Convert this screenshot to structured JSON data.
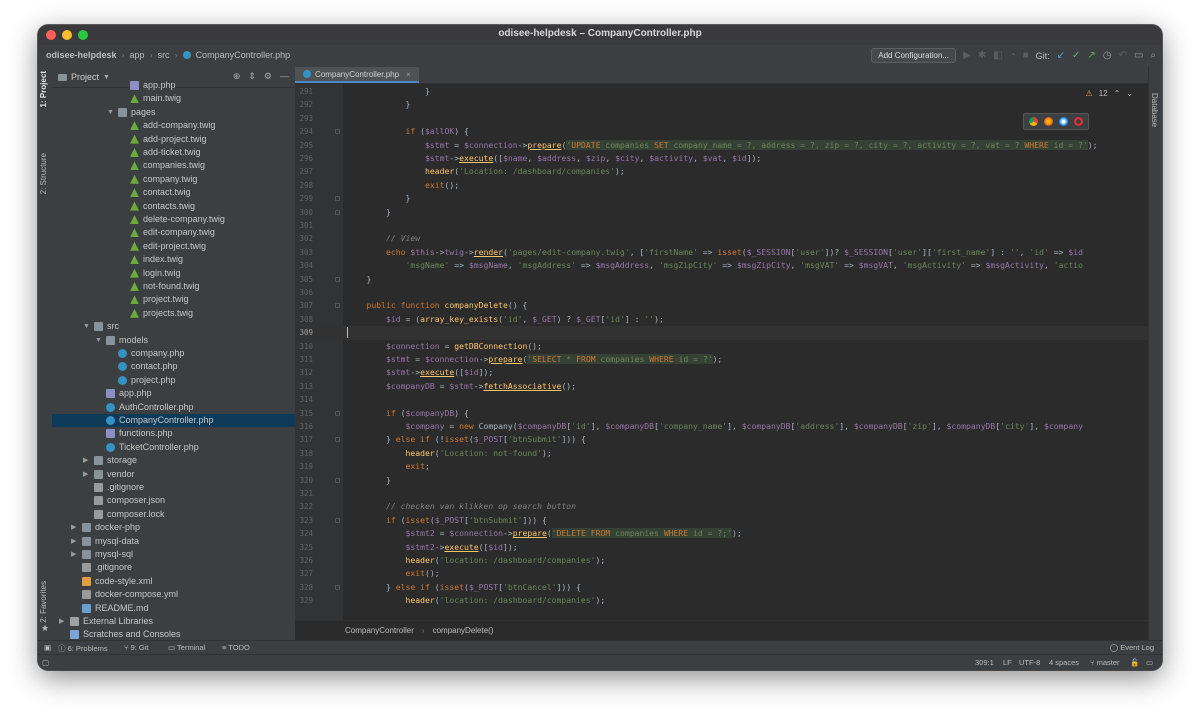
{
  "window": {
    "title": "odisee-helpdesk – CompanyController.php"
  },
  "nav": {
    "crumbs": [
      "odisee-helpdesk",
      "app",
      "src",
      "CompanyController.php"
    ],
    "add_config": "Add Configuration...",
    "git_label": "Git:"
  },
  "side_tabs": {
    "project": "1: Project",
    "structure": "2: Structure",
    "favorites": "2: Favorites"
  },
  "right_tabs": {
    "database": "Database"
  },
  "project": {
    "title": "Project",
    "tree": [
      {
        "label": "app.php",
        "icon": "php",
        "depth": 6
      },
      {
        "label": "main.twig",
        "icon": "twig",
        "depth": 6
      },
      {
        "label": "pages",
        "icon": "folder",
        "depth": 5,
        "arrow": "down"
      },
      {
        "label": "add-company.twig",
        "icon": "twig",
        "depth": 6
      },
      {
        "label": "add-project.twig",
        "icon": "twig",
        "depth": 6
      },
      {
        "label": "add-ticket.twig",
        "icon": "twig",
        "depth": 6
      },
      {
        "label": "companies.twig",
        "icon": "twig",
        "depth": 6
      },
      {
        "label": "company.twig",
        "icon": "twig",
        "depth": 6
      },
      {
        "label": "contact.twig",
        "icon": "twig",
        "depth": 6
      },
      {
        "label": "contacts.twig",
        "icon": "twig",
        "depth": 6
      },
      {
        "label": "delete-company.twig",
        "icon": "twig",
        "depth": 6
      },
      {
        "label": "edit-company.twig",
        "icon": "twig",
        "depth": 6
      },
      {
        "label": "edit-project.twig",
        "icon": "twig",
        "depth": 6
      },
      {
        "label": "index.twig",
        "icon": "twig",
        "depth": 6
      },
      {
        "label": "login.twig",
        "icon": "twig",
        "depth": 6
      },
      {
        "label": "not-found.twig",
        "icon": "twig",
        "depth": 6
      },
      {
        "label": "project.twig",
        "icon": "twig",
        "depth": 6
      },
      {
        "label": "projects.twig",
        "icon": "twig",
        "depth": 6
      },
      {
        "label": "src",
        "icon": "folder",
        "depth": 3,
        "arrow": "down"
      },
      {
        "label": "models",
        "icon": "folder",
        "depth": 4,
        "arrow": "down"
      },
      {
        "label": "company.php",
        "icon": "class",
        "depth": 5
      },
      {
        "label": "contact.php",
        "icon": "class",
        "depth": 5
      },
      {
        "label": "project.php",
        "icon": "class",
        "depth": 5
      },
      {
        "label": "app.php",
        "icon": "php",
        "depth": 4
      },
      {
        "label": "AuthController.php",
        "icon": "class",
        "depth": 4
      },
      {
        "label": "CompanyController.php",
        "icon": "class",
        "depth": 4,
        "selected": true
      },
      {
        "label": "functions.php",
        "icon": "php",
        "depth": 4
      },
      {
        "label": "TicketController.php",
        "icon": "class",
        "depth": 4
      },
      {
        "label": "storage",
        "icon": "folder",
        "depth": 3,
        "arrow": "right"
      },
      {
        "label": "vendor",
        "icon": "folder",
        "depth": 3,
        "arrow": "right"
      },
      {
        "label": ".gitignore",
        "icon": "file",
        "depth": 3
      },
      {
        "label": "composer.json",
        "icon": "file",
        "depth": 3
      },
      {
        "label": "composer.lock",
        "icon": "file",
        "depth": 3
      },
      {
        "label": "docker-php",
        "icon": "folder",
        "depth": 2,
        "arrow": "right"
      },
      {
        "label": "mysql-data",
        "icon": "folder",
        "depth": 2,
        "arrow": "right"
      },
      {
        "label": "mysql-sql",
        "icon": "folder",
        "depth": 2,
        "arrow": "right"
      },
      {
        "label": ".gitignore",
        "icon": "file",
        "depth": 2
      },
      {
        "label": "code-style.xml",
        "icon": "xml",
        "depth": 2
      },
      {
        "label": "docker-compose.yml",
        "icon": "file",
        "depth": 2
      },
      {
        "label": "README.md",
        "icon": "md",
        "depth": 2
      },
      {
        "label": "External Libraries",
        "icon": "lib",
        "depth": 1,
        "arrow": "right"
      },
      {
        "label": "Scratches and Consoles",
        "icon": "scratch",
        "depth": 1
      }
    ]
  },
  "editor": {
    "tab": "CompanyController.php",
    "warnings": "12",
    "breadcrumb": [
      "CompanyController",
      "companyDelete()"
    ],
    "lines": [
      {
        "n": "291",
        "html": "                }"
      },
      {
        "n": "292",
        "html": "            }"
      },
      {
        "n": "293",
        "html": ""
      },
      {
        "n": "294",
        "html": "            <span class='k'>if</span> (<span class='v'>$allOK</span>) {"
      },
      {
        "n": "295",
        "html": "                <span class='v'>$stmt</span> = <span class='v'>$connection</span>-><span class='m'>prepare</span>(<span class='s sql'>'<span class='k'>UPDATE</span> companies <span class='k'>SET</span> company_name = ?, address = ?, zip = ?, city = ?, activity = ?, vat = ? <span class='k'>WHERE</span> id = ?'</span>);"
      },
      {
        "n": "296",
        "html": "                <span class='v'>$stmt</span>-><span class='m'>execute</span>([<span class='v'>$name</span>, <span class='v'>$address</span>, <span class='v'>$zip</span>, <span class='v'>$city</span>, <span class='v'>$activity</span>, <span class='v'>$vat</span>, <span class='v'>$id</span>]);"
      },
      {
        "n": "297",
        "html": "                <span class='f'>header</span>(<span class='s'>'Location: /dashboard/companies'</span>);"
      },
      {
        "n": "298",
        "html": "                <span class='k'>exit</span>();"
      },
      {
        "n": "299",
        "html": "            }"
      },
      {
        "n": "300",
        "html": "        }"
      },
      {
        "n": "301",
        "html": ""
      },
      {
        "n": "302",
        "html": "        <span class='c'>// View</span>"
      },
      {
        "n": "303",
        "html": "        <span class='k'>echo</span> <span class='v'>$this</span>-><span class='v'>twig</span>-><span class='m'>render</span>(<span class='s'>'pages/edit-company.twig'</span>, [<span class='s'>'firstName'</span> => <span class='k'>isset</span>(<span class='v'>$_SESSION</span>[<span class='s'>'user'</span>])? <span class='v'>$_SESSION</span>[<span class='s'>'user'</span>][<span class='s'>'first_name'</span>] : <span class='s'>''</span>, <span class='s'>'id'</span> => <span class='v'>$id</span>"
      },
      {
        "n": "304",
        "html": "            <span class='s'>'msgName'</span> => <span class='v'>$msgName</span>, <span class='s'>'msgAddress'</span> => <span class='v'>$msgAddress</span>, <span class='s'>'msgZipCity'</span> => <span class='v'>$msgZipCity</span>, <span class='s'>'msgVAT'</span> => <span class='v'>$msgVAT</span>, <span class='s'>'msgActivity'</span> => <span class='v'>$msgActivity</span>, <span class='s'>'actio</span>"
      },
      {
        "n": "305",
        "html": "    }"
      },
      {
        "n": "306",
        "html": ""
      },
      {
        "n": "307",
        "html": "    <span class='k'>public function</span> <span class='f'>companyDelete</span>() {"
      },
      {
        "n": "308",
        "html": "        <span class='v'>$id</span> = (<span class='f'>array_key_exists</span>(<span class='s'>'id'</span>, <span class='v'>$_GET</span>) ? <span class='v'>$_GET</span>[<span class='s'>'id'</span>] : <span class='s'>''</span>);"
      },
      {
        "n": "309",
        "html": "",
        "current": true
      },
      {
        "n": "310",
        "html": "        <span class='v'>$connection</span> = <span class='f'>getDBConnection</span>();"
      },
      {
        "n": "311",
        "html": "        <span class='v'>$stmt</span> = <span class='v'>$connection</span>-><span class='m'>prepare</span>(<span class='s sql'>'<span class='k'>SELECT</span> * <span class='k'>FROM</span> companies <span class='k'>WHERE</span> id = ?'</span>);"
      },
      {
        "n": "312",
        "html": "        <span class='v'>$stmt</span>-><span class='m'>execute</span>([<span class='v'>$id</span>]);"
      },
      {
        "n": "313",
        "html": "        <span class='v'>$companyDB</span> = <span class='v'>$stmt</span>-><span class='m'>fetchAssociative</span>();"
      },
      {
        "n": "314",
        "html": ""
      },
      {
        "n": "315",
        "html": "        <span class='k'>if</span> (<span class='v'>$companyDB</span>) {"
      },
      {
        "n": "316",
        "html": "            <span class='v'>$company</span> = <span class='k'>new</span> Company(<span class='v'>$companyDB</span>[<span class='s'>'id'</span>], <span class='v'>$companyDB</span>[<span class='s'>'company_name'</span>], <span class='v'>$companyDB</span>[<span class='s'>'address'</span>], <span class='v'>$companyDB</span>[<span class='s'>'zip'</span>], <span class='v'>$companyDB</span>[<span class='s'>'city'</span>], <span class='v'>$company</span>"
      },
      {
        "n": "317",
        "html": "        } <span class='k'>else if</span> (!<span class='k'>isset</span>(<span class='v'>$_POST</span>[<span class='s'>'btnSubmit'</span>])) {"
      },
      {
        "n": "318",
        "html": "            <span class='f'>header</span>(<span class='s'>'Location: not-found'</span>);"
      },
      {
        "n": "319",
        "html": "            <span class='k'>exit</span>;"
      },
      {
        "n": "320",
        "html": "        }"
      },
      {
        "n": "321",
        "html": ""
      },
      {
        "n": "322",
        "html": "        <span class='c'>// checken van klikken op search button</span>"
      },
      {
        "n": "323",
        "html": "        <span class='k'>if</span> (<span class='k'>isset</span>(<span class='v'>$_POST</span>[<span class='s'>'btnSubmit'</span>])) {"
      },
      {
        "n": "324",
        "html": "            <span class='v'>$stmt2</span> = <span class='v'>$connection</span>-><span class='m'>prepare</span>(<span class='s sql'>'<span class='k'>DELETE FROM</span> companies <span class='k'>WHERE</span> id = ?;'</span>);"
      },
      {
        "n": "325",
        "html": "            <span class='v'>$stmt2</span>-><span class='m'>execute</span>([<span class='v'>$id</span>]);"
      },
      {
        "n": "326",
        "html": "            <span class='f'>header</span>(<span class='s'>'location: /dashboard/companies'</span>);"
      },
      {
        "n": "327",
        "html": "            <span class='k'>exit</span>();"
      },
      {
        "n": "328",
        "html": "        } <span class='k'>else if</span> (<span class='k'>isset</span>(<span class='v'>$_POST</span>[<span class='s'>'btnCancel'</span>])) {"
      },
      {
        "n": "329",
        "html": "            <span class='f'>header</span>(<span class='s'>'location: /dashboard/companies'</span>);"
      }
    ]
  },
  "toolbar": {
    "problems": "6: Problems",
    "git": "9: Git",
    "terminal": "Terminal",
    "todo": "TODO",
    "event_log": "Event Log"
  },
  "status": {
    "position": "309:1",
    "line_sep": "LF",
    "encoding": "UTF-8",
    "indent": "4 spaces",
    "branch": "master"
  },
  "colors": {
    "selection": "#0d3a58",
    "accent": "#4a88c7",
    "twig": "#6bab3a",
    "php": "#8c8fc7",
    "class": "#3592c4"
  }
}
